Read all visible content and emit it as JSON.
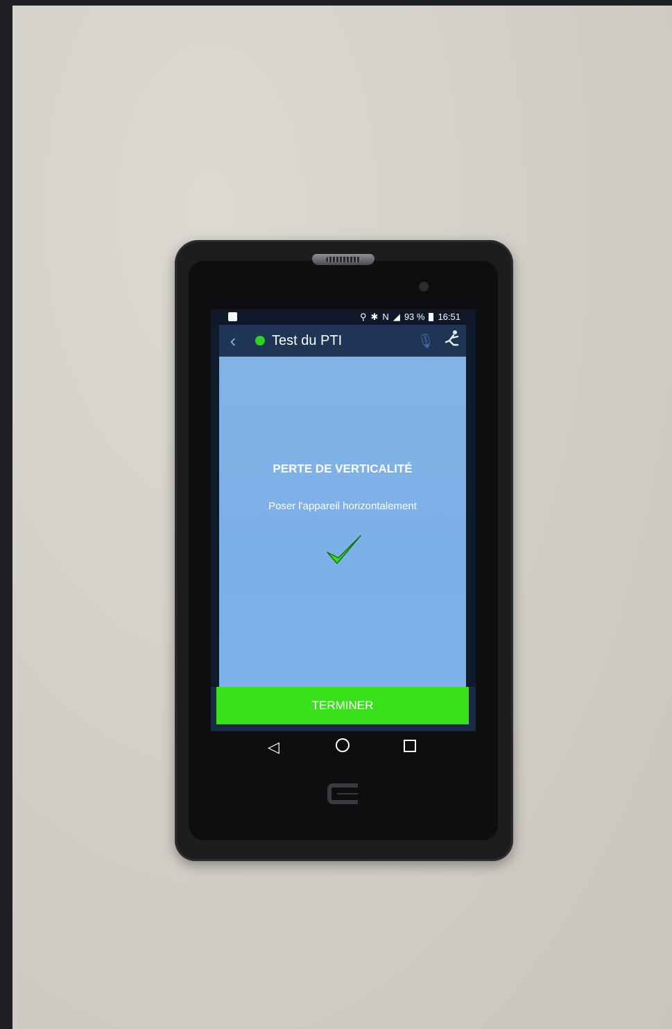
{
  "status_bar": {
    "battery": "93 %",
    "time": "16:51",
    "icons": [
      "image-icon",
      "location-icon",
      "bluetooth-icon",
      "nfc-icon",
      "signal-4g-icon",
      "battery-icon"
    ]
  },
  "app_bar": {
    "title": "Test du PTI",
    "status_color": "#2fd223",
    "icons": [
      "back-icon",
      "microphone-icon",
      "man-down-icon"
    ]
  },
  "content": {
    "title": "PERTE DE VERTICALITÉ",
    "instruction": "Poser l'appareil horizontalement",
    "result_icon": "check-icon"
  },
  "footer": {
    "button_label": "TERMINER",
    "button_color": "#3be01c"
  },
  "navigation": {
    "icons": [
      "nav-back-icon",
      "nav-home-icon",
      "nav-recent-icon"
    ]
  }
}
